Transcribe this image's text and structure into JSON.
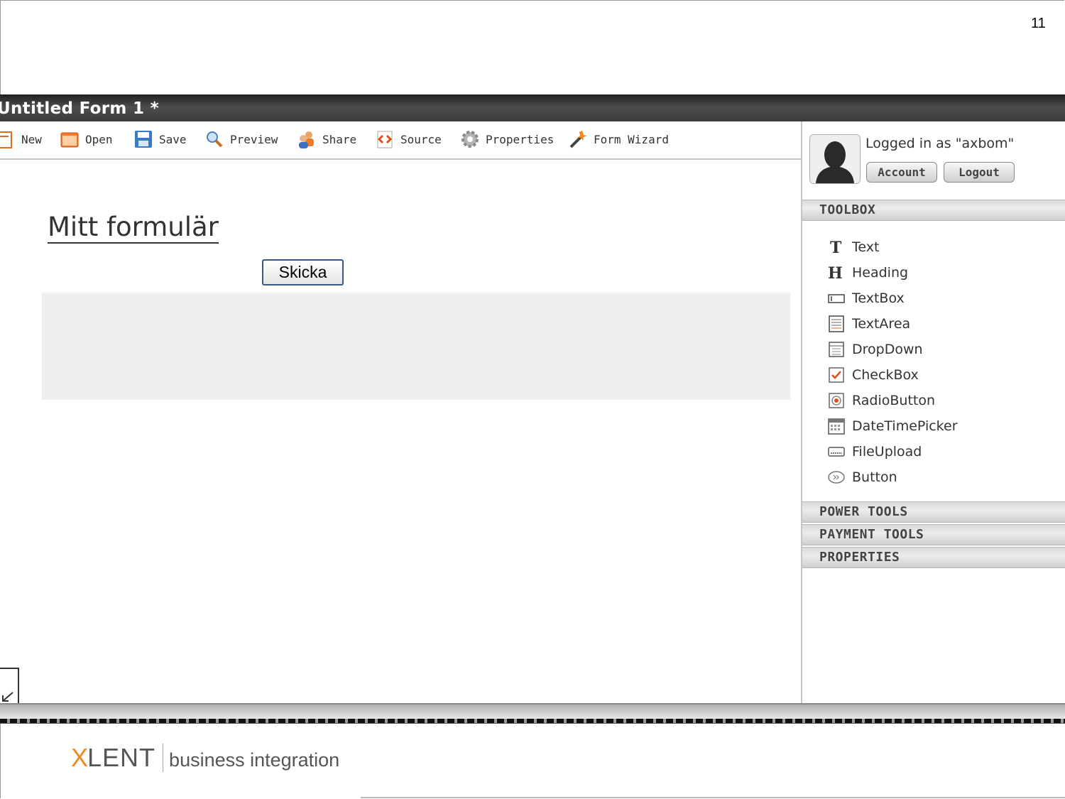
{
  "slide": {
    "page_number": "11"
  },
  "form": {
    "title": "Untitled Form 1 *"
  },
  "toolbar": {
    "items": [
      {
        "label": "New",
        "icon": "new-document-icon"
      },
      {
        "label": "Open",
        "icon": "open-folder-icon"
      },
      {
        "label": "Save",
        "icon": "floppy-disk-icon"
      },
      {
        "label": "Preview",
        "icon": "magnifier-icon"
      },
      {
        "label": "Share",
        "icon": "people-icon"
      },
      {
        "label": "Source",
        "icon": "code-icon"
      },
      {
        "label": "Properties",
        "icon": "gear-icon"
      },
      {
        "label": "Form Wizard",
        "icon": "magic-wand-icon"
      }
    ]
  },
  "canvas": {
    "heading": "Mitt formulär",
    "submit_label": "Skicka"
  },
  "user": {
    "logged_in_text": "Logged in as \"axbom\"",
    "account_label": "Account",
    "logout_label": "Logout"
  },
  "sidebar": {
    "toolbox_label": "TOOLBOX",
    "tools": [
      {
        "label": "Text",
        "icon": "text-t-icon"
      },
      {
        "label": "Heading",
        "icon": "heading-h-icon"
      },
      {
        "label": "TextBox",
        "icon": "textbox-icon"
      },
      {
        "label": "TextArea",
        "icon": "textarea-icon"
      },
      {
        "label": "DropDown",
        "icon": "dropdown-icon"
      },
      {
        "label": "CheckBox",
        "icon": "checkbox-icon"
      },
      {
        "label": "RadioButton",
        "icon": "radio-button-icon"
      },
      {
        "label": "DateTimePicker",
        "icon": "calendar-icon"
      },
      {
        "label": "FileUpload",
        "icon": "file-upload-icon"
      },
      {
        "label": "Button",
        "icon": "button-icon"
      }
    ],
    "power_tools_label": "POWER TOOLS",
    "payment_tools_label": "PAYMENT TOOLS",
    "properties_label": "PROPERTIES"
  },
  "footer": {
    "brand_x": "X",
    "brand_rest": "LENT",
    "tagline": "business integration"
  },
  "colors": {
    "accent_orange": "#f08a1f",
    "titlebar": "#3a3a3a",
    "submit_border": "#355a86"
  }
}
